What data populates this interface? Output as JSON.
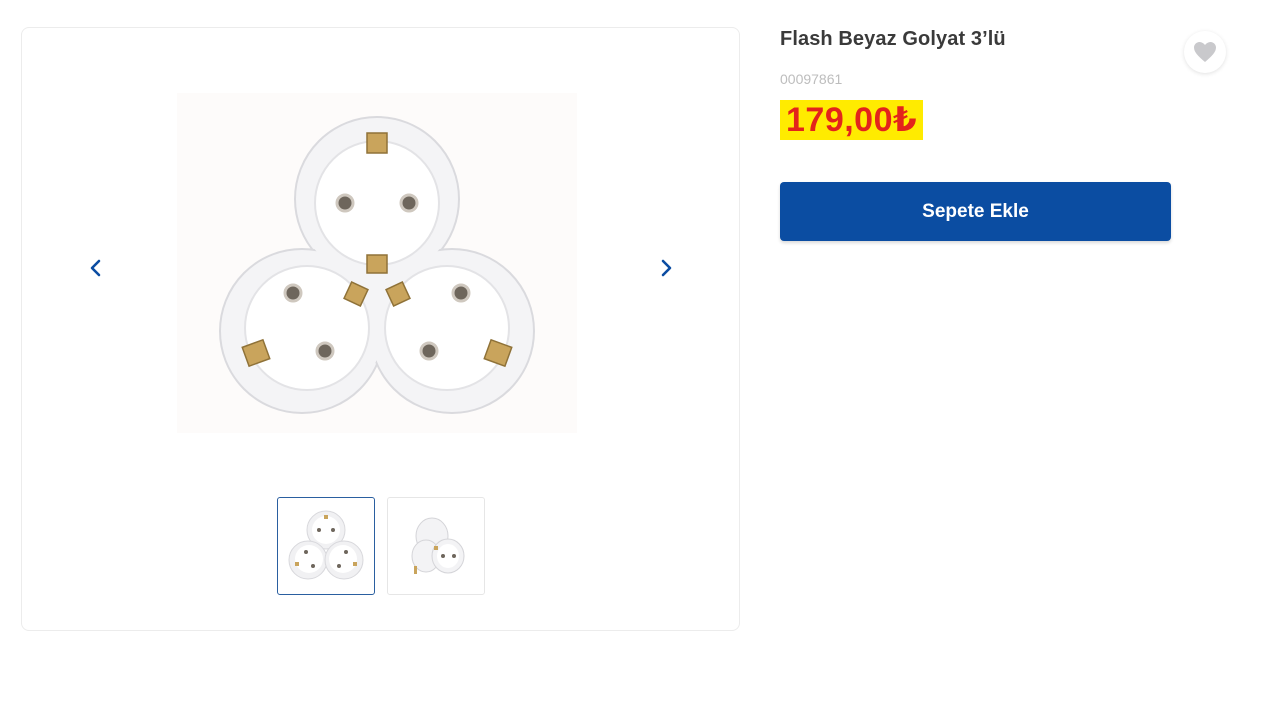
{
  "product": {
    "title": "Flash Beyaz Golyat 3’lü",
    "sku": "00097861",
    "price": "179,00₺",
    "add_to_cart_label": "Sepete Ekle"
  },
  "gallery": {
    "thumbnails": [
      {
        "name": "thumbnail-front",
        "active": true
      },
      {
        "name": "thumbnail-side",
        "active": false
      }
    ]
  },
  "icons": {
    "prev": "chevron-left-icon",
    "next": "chevron-right-icon",
    "favorite": "heart-icon"
  },
  "colors": {
    "primary_button": "#0b4da2",
    "price_text": "#e3241b",
    "price_highlight": "#ffeb00",
    "thumbnail_active_border": "#2a5fa0"
  }
}
